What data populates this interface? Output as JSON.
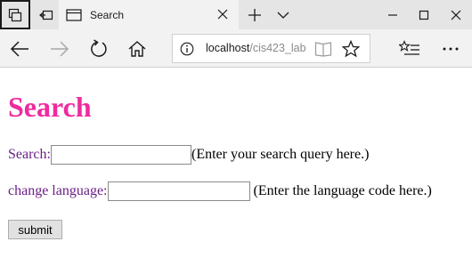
{
  "browser": {
    "tab": {
      "title": "Search"
    },
    "address": {
      "host": "localhost",
      "path": "/cis423_lab"
    }
  },
  "page": {
    "heading": "Search",
    "search_label": "Search:",
    "search_value": "",
    "search_hint": "(Enter your search query here.)",
    "language_label": "change language:",
    "language_value": "",
    "language_hint": "(Enter the language code here.)",
    "submit_label": "submit"
  },
  "icons": {
    "set_aside": "tabs-aside-icon",
    "show_aside": "show-tabs-aside-icon",
    "page": "page-icon",
    "close_tab": "close-icon",
    "new_tab": "plus-icon",
    "tab_list": "chevron-down-icon",
    "minimize": "minimize-icon",
    "maximize": "maximize-icon",
    "close_window": "close-icon",
    "back": "back-arrow-icon",
    "forward": "forward-arrow-icon",
    "refresh": "refresh-icon",
    "home": "home-icon",
    "info": "info-icon",
    "reading": "reading-view-icon",
    "favorite": "star-icon",
    "hub": "favorites-hub-icon",
    "more": "more-icon"
  },
  "colors": {
    "heading": "#ee2b9f",
    "label": "#6b1f86"
  }
}
